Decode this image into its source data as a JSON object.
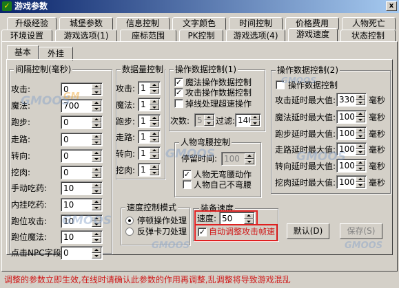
{
  "window": {
    "title": "游戏参数",
    "icon": "game-app-icon",
    "close": "x"
  },
  "tabs_row1": [
    "升级经验",
    "城堡参数",
    "信息控制",
    "文字颜色",
    "时间控制",
    "价格费用",
    "人物死亡"
  ],
  "tabs_row2": [
    "环境设置",
    "游戏选项(1)",
    "座标范围",
    "PK控制",
    "游戏选项(4)",
    "游戏速度",
    "状态控制"
  ],
  "selected_tab": "游戏速度",
  "subtabs": [
    "基本",
    "外挂"
  ],
  "interval": {
    "title": "间隔控制(毫秒)",
    "rows": [
      {
        "label": "攻击:",
        "value": "0"
      },
      {
        "label": "魔法:",
        "value": "700"
      },
      {
        "label": "跑步:",
        "value": "0"
      },
      {
        "label": "走路:",
        "value": "0"
      },
      {
        "label": "转向:",
        "value": "0"
      },
      {
        "label": "挖肉:",
        "value": "0"
      },
      {
        "label": "手动吃药:",
        "value": "10"
      },
      {
        "label": "内挂吃药:",
        "value": "10"
      },
      {
        "label": "跑位攻击:",
        "value": "10"
      },
      {
        "label": "跑位魔法:",
        "value": "10"
      },
      {
        "label": "点击NPC字段:",
        "value": "0"
      }
    ]
  },
  "counts": {
    "title": "数据量控制",
    "rows": [
      {
        "label": "攻击:",
        "value": "1"
      },
      {
        "label": "魔法:",
        "value": "1"
      },
      {
        "label": "跑步:",
        "value": "1"
      },
      {
        "label": "走路:",
        "value": "1"
      },
      {
        "label": "转向:",
        "value": "1"
      },
      {
        "label": "挖肉:",
        "value": "1"
      }
    ]
  },
  "opctl1": {
    "title": "操作数据控制(1)",
    "checks": [
      {
        "label": "魔法操作数据控制",
        "checked": true
      },
      {
        "label": "攻击操作数据控制",
        "checked": true
      },
      {
        "label": "掉线处理超速操作",
        "checked": false
      }
    ],
    "count_label": "次数:",
    "count_value": "5",
    "filter_label": "过滤:",
    "filter_value": "140"
  },
  "bend": {
    "title": "人物弯腰控制",
    "stay_label": "停留时间:",
    "stay_value": "100",
    "checks": [
      {
        "label": "人物无弯腰动作",
        "checked": true
      },
      {
        "label": "人物自己不弯腰",
        "checked": false
      }
    ]
  },
  "opctl2": {
    "title": "操作数据控制(2)",
    "check_label": "操作数据控制",
    "checked": false,
    "unit": "毫秒",
    "rows": [
      {
        "label": "攻击延时最大值:",
        "value": "330"
      },
      {
        "label": "魔法延时最大值:",
        "value": "100"
      },
      {
        "label": "跑步延时最大值:",
        "value": "100"
      },
      {
        "label": "走路延时最大值:",
        "value": "100"
      },
      {
        "label": "转向延时最大值:",
        "value": "100"
      },
      {
        "label": "挖肉延时最大值:",
        "value": "100"
      }
    ]
  },
  "speedmode": {
    "title": "速度控制模式",
    "options": [
      {
        "label": "停顿操作处理",
        "selected": true
      },
      {
        "label": "反弹卡刀处理",
        "selected": false
      }
    ]
  },
  "equip": {
    "title": "装备速度",
    "speed_label": "速度:",
    "speed_value": "50",
    "auto_label": "自动调整攻击帧速",
    "auto_checked": true
  },
  "buttons": {
    "default": "默认(D)",
    "save": "保存(S)"
  },
  "watermark": {
    "brand": "GMOOS",
    "sub": "GM"
  },
  "footer": "调整的参数立即生效,在线时请确认此参数的作用再调整,乱调整将导致游戏混乱",
  "colors": {
    "footer": "#d01818",
    "highlight": "#e02020",
    "title_from": "#0a246a",
    "title_to": "#a6caf0"
  }
}
